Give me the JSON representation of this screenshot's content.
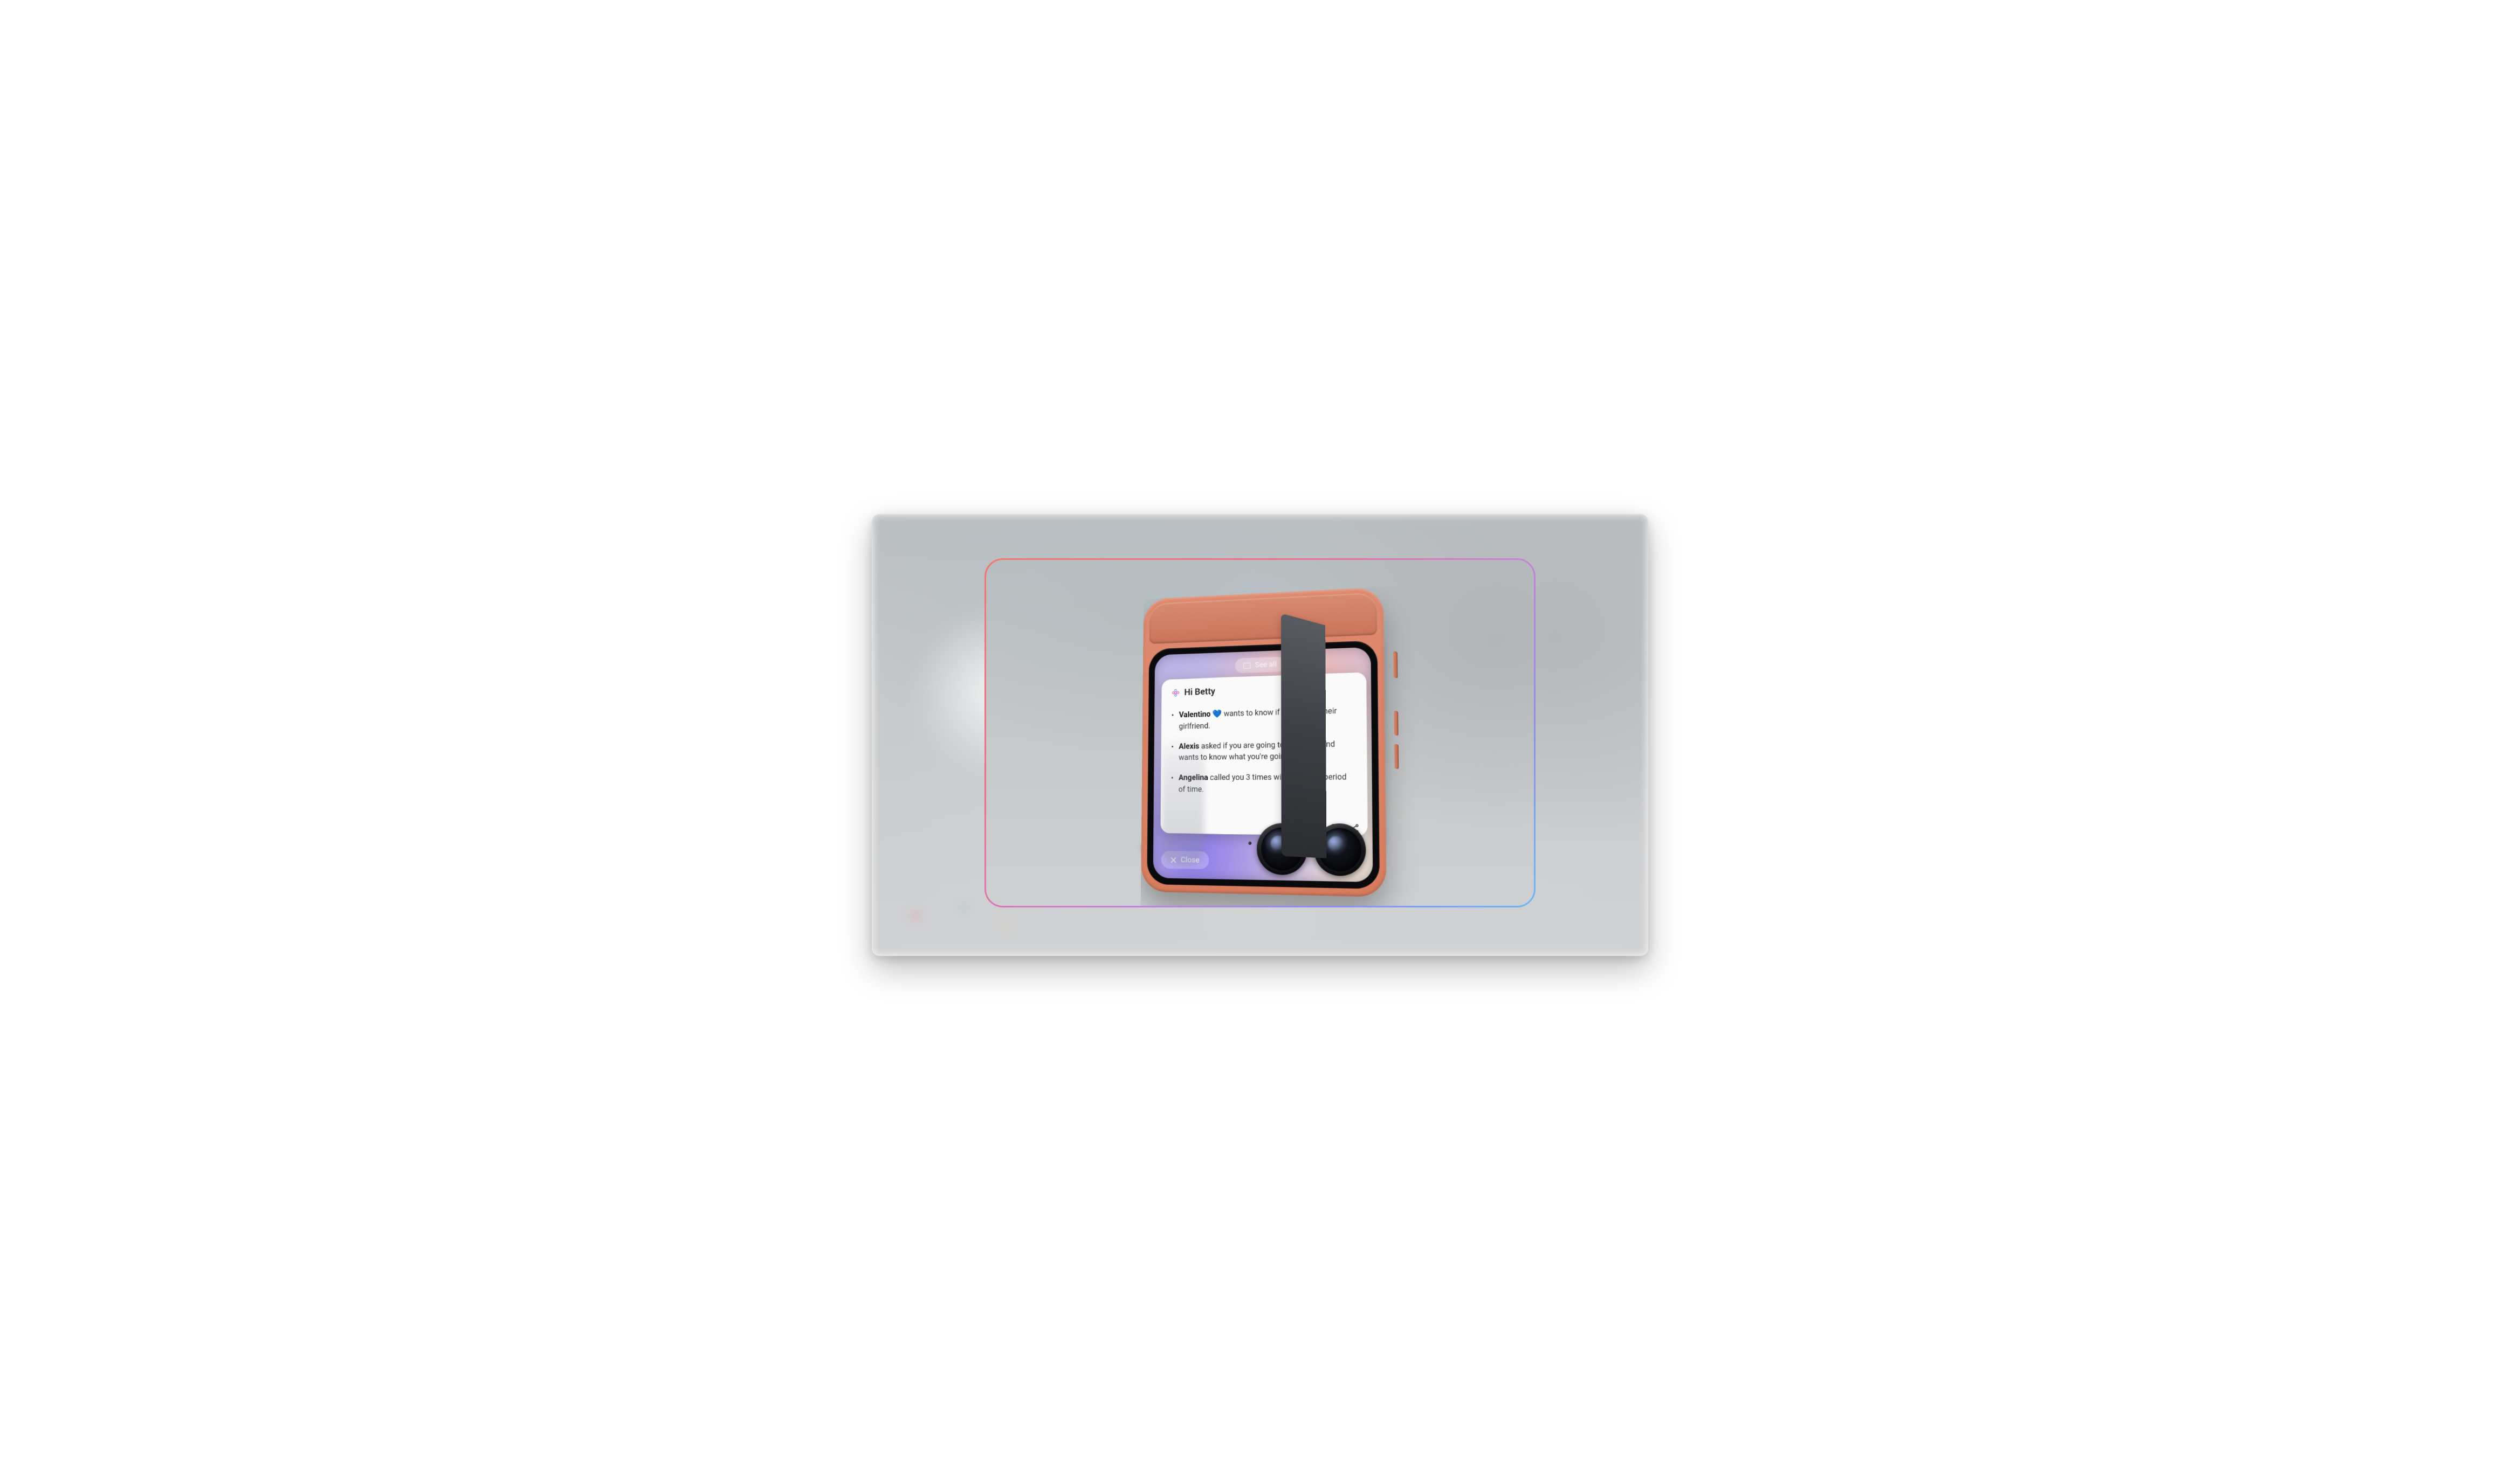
{
  "top_pill": {
    "label": "See all"
  },
  "card": {
    "greeting": "Hi Betty",
    "items": [
      {
        "name": "Valentino",
        "emoji": "💙",
        "rest": " wants to know if you will be their girlfriend."
      },
      {
        "name": "Alexis",
        "emoji": "",
        "rest": " asked if you are going to the game and wants to know what you're going to wear."
      },
      {
        "name": "Angelina",
        "emoji": "",
        "rest": " called you 3 times within a short period of time."
      }
    ]
  },
  "close_button": {
    "label": "Close"
  }
}
